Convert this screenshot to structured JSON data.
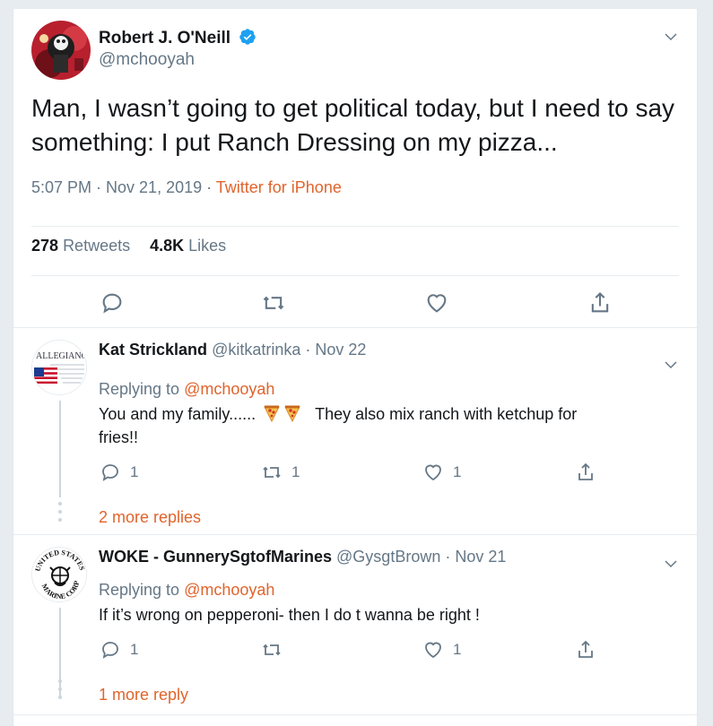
{
  "main_tweet": {
    "author_name": "Robert J. O'Neill",
    "author_handle": "@mchooyah",
    "text": "Man, I wasn’t going to get political today, but I need to say something: I put Ranch Dressing on my pizza...",
    "time": "5:07 PM · Nov 21, 2019 · ",
    "source": "Twitter for iPhone",
    "retweets_count": "278",
    "retweets_label": "Retweets",
    "likes_count": "4.8K",
    "likes_label": "Likes"
  },
  "replies": [
    {
      "author_name": "Kat Strickland",
      "author_handle": "@kitkatrinka",
      "date": " · Nov 22",
      "avatar_text": "ALLEGIANC",
      "replying_prefix": "Replying to ",
      "replying_to": "@mchooyah",
      "text_before_emoji": "You and my family......",
      "text_after_emoji": "They also mix ranch with ketchup for",
      "text_line2": "fries!!",
      "reply_count": "1",
      "retweet_count": "1",
      "like_count": "1",
      "more_replies": "2 more replies"
    },
    {
      "author_name": "WOKE - GunnerySgtofMarines",
      "author_handle": "@GysgtBrown",
      "date": " · Nov 21",
      "avatar_text_top": "UNITED STATES",
      "avatar_text_bottom": "MARINE CORPS",
      "replying_prefix": "Replying to ",
      "replying_to": "@mchooyah",
      "text": "If it’s wrong on pepperoni- then I do t wanna be right !",
      "reply_count": "1",
      "retweet_count": "",
      "like_count": "1",
      "more_replies": "1 more reply"
    }
  ],
  "icons": {
    "verified": "verified-badge-icon",
    "chevron": "chevron-down-icon",
    "reply": "reply-icon",
    "retweet": "retweet-icon",
    "like": "heart-icon",
    "share": "share-icon",
    "emoji": "pizza-emoji-icon"
  },
  "colors": {
    "accent": "#e0642c",
    "secondary_text": "#657786",
    "verified": "#1da1f2"
  }
}
